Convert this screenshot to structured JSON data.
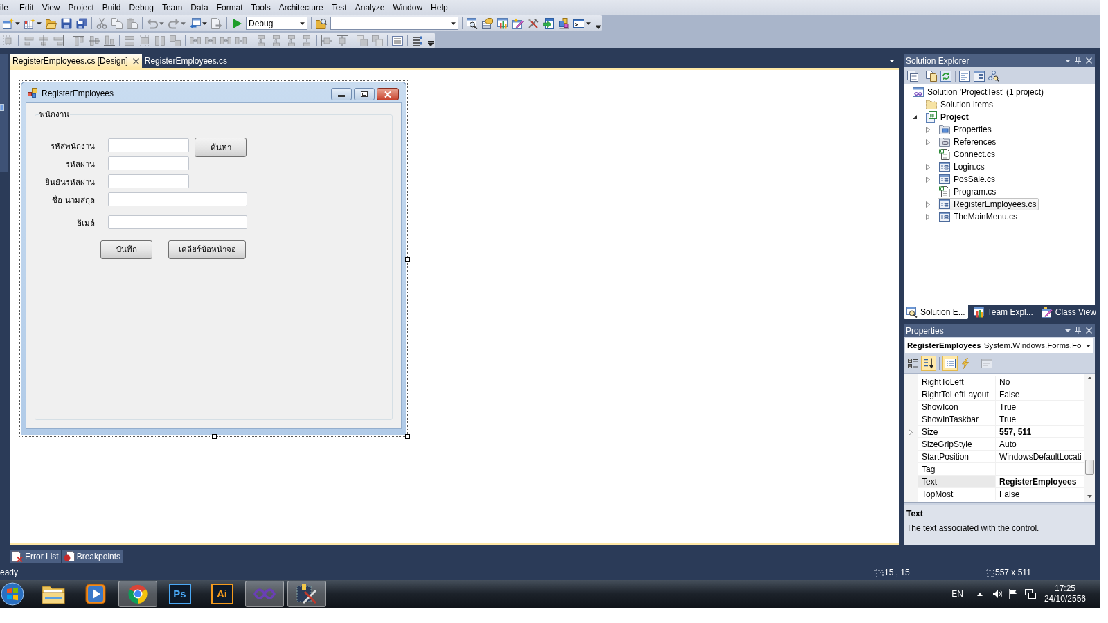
{
  "menu_bar": {
    "items": [
      "ile",
      "Edit",
      "View",
      "Project",
      "Build",
      "Debug",
      "Team",
      "Data",
      "Format",
      "Tools",
      "Architecture",
      "Test",
      "Analyze",
      "Window",
      "Help"
    ]
  },
  "toolbars": [
    {
      "groups": [
        [
          {
            "kind": "new_project",
            "dropdown": true,
            "disabled": false
          },
          {
            "kind": "add_item",
            "dropdown": true,
            "disabled": false
          },
          {
            "kind": "open",
            "disabled": false
          },
          {
            "kind": "save",
            "disabled": false
          },
          {
            "kind": "save_all",
            "disabled": false
          }
        ],
        [
          {
            "kind": "cut",
            "disabled": true
          },
          {
            "kind": "copy",
            "disabled": true
          },
          {
            "kind": "paste",
            "disabled": true
          }
        ],
        [
          {
            "kind": "undo",
            "dropdown": true,
            "disabled": true
          },
          {
            "kind": "redo",
            "dropdown": true,
            "disabled": true
          },
          {
            "kind": "navigate_back",
            "dropdown": true,
            "disabled": false
          },
          {
            "kind": "navigate_forward",
            "disabled": true
          }
        ],
        [
          {
            "kind": "start",
            "disabled": false
          },
          {
            "kind": "config_combo",
            "value": "Debug",
            "disabled": false
          }
        ],
        [
          {
            "kind": "find_in_files",
            "disabled": false
          },
          {
            "kind": "find_combo",
            "disabled": false
          }
        ],
        [
          {
            "kind": "window_search",
            "disabled": false
          },
          {
            "kind": "hand",
            "disabled": false
          },
          {
            "kind": "chart",
            "disabled": false
          },
          {
            "kind": "window_pencil",
            "disabled": false
          },
          {
            "kind": "tools",
            "disabled": false
          },
          {
            "kind": "arrow_box",
            "disabled": false
          },
          {
            "kind": "blocks",
            "disabled": false
          },
          {
            "kind": "console",
            "dropdown": true,
            "disabled": false
          }
        ]
      ]
    },
    {
      "groups": [
        [
          {
            "kind": "grid",
            "disabled": true
          }
        ],
        [
          {
            "kind": "align_left",
            "disabled": true
          },
          {
            "kind": "align_center",
            "disabled": true
          },
          {
            "kind": "align_right",
            "disabled": true
          }
        ],
        [
          {
            "kind": "align_top",
            "disabled": true
          },
          {
            "kind": "align_middle",
            "disabled": true
          },
          {
            "kind": "align_bottom",
            "disabled": true
          }
        ],
        [
          {
            "kind": "same_width",
            "disabled": true
          },
          {
            "kind": "size_to_grid",
            "disabled": true
          },
          {
            "kind": "same_height",
            "disabled": true
          },
          {
            "kind": "same_size",
            "disabled": true
          }
        ],
        [
          {
            "kind": "hspace_equal",
            "disabled": true
          },
          {
            "kind": "hspace_increase",
            "disabled": true
          },
          {
            "kind": "hspace_decrease",
            "disabled": true
          },
          {
            "kind": "hspace_remove",
            "disabled": true
          }
        ],
        [
          {
            "kind": "vspace_equal",
            "disabled": true
          },
          {
            "kind": "vspace_increase",
            "disabled": true
          },
          {
            "kind": "vspace_decrease",
            "disabled": true
          },
          {
            "kind": "vspace_remove",
            "disabled": true
          }
        ],
        [
          {
            "kind": "center_horizontal",
            "disabled": true
          },
          {
            "kind": "center_vertical",
            "disabled": true
          }
        ],
        [
          {
            "kind": "bring_front",
            "disabled": true
          },
          {
            "kind": "send_back",
            "disabled": true
          }
        ],
        [
          {
            "kind": "lines",
            "disabled": false
          }
        ],
        [
          {
            "kind": "tab_order",
            "disabled": false
          }
        ]
      ]
    }
  ],
  "document_tabs": [
    {
      "label": "RegisterEmployees.cs [Design]",
      "selected": true
    },
    {
      "label": "RegisterEmployees.cs",
      "selected": false
    }
  ],
  "designer": {
    "form": {
      "title": "RegisterEmployees",
      "selected": true,
      "group": {
        "title": "พนักงาน",
        "fields": [
          {
            "label": "รหัสพนักงาน",
            "button": "ค้นหา"
          },
          {
            "label": "รหัสผ่าน"
          },
          {
            "label": "ยินยันรหัสผ่าน"
          },
          {
            "label": "ชื่อ-นามสกุล"
          },
          {
            "label": "อิเมล์"
          }
        ],
        "actions": [
          "บันทึก",
          "เคลียร์ข้อหน้าจอ"
        ]
      }
    }
  },
  "solution_explorer": {
    "title": "Solution Explorer",
    "tree": [
      {
        "label": "Solution 'ProjectTest' (1 project)",
        "kind": "solution",
        "expandable": false,
        "selected": false,
        "startup": false,
        "children": [
          {
            "label": "Solution Items",
            "kind": "folder",
            "expandable": false,
            "selected": false,
            "startup": false
          },
          {
            "label": "Project",
            "kind": "project",
            "expandable": true,
            "expanded": true,
            "selected": false,
            "startup": true,
            "children": [
              {
                "label": "Properties",
                "kind": "properties",
                "expandable": true,
                "expanded": false,
                "selected": false,
                "startup": false
              },
              {
                "label": "References",
                "kind": "references",
                "expandable": true,
                "expanded": false,
                "selected": false,
                "startup": false
              },
              {
                "label": "Connect.cs",
                "kind": "code",
                "expandable": false,
                "selected": false,
                "startup": false
              },
              {
                "label": "Login.cs",
                "kind": "form",
                "expandable": true,
                "expanded": false,
                "selected": false,
                "startup": false
              },
              {
                "label": "PosSale.cs",
                "kind": "form",
                "expandable": true,
                "expanded": false,
                "selected": false,
                "startup": false
              },
              {
                "label": "Program.cs",
                "kind": "code",
                "expandable": false,
                "selected": false,
                "startup": false
              },
              {
                "label": "RegisterEmployees.cs",
                "kind": "form",
                "expandable": true,
                "expanded": false,
                "selected": true,
                "startup": false
              },
              {
                "label": "TheMainMenu.cs",
                "kind": "form",
                "expandable": true,
                "expanded": false,
                "selected": false,
                "startup": false
              }
            ]
          }
        ]
      }
    ],
    "tabs": [
      {
        "label": "Solution E...",
        "kind": "solution_explorer",
        "selected": true
      },
      {
        "label": "Team Expl...",
        "kind": "team_explorer",
        "selected": false
      },
      {
        "label": "Class View",
        "kind": "class_view",
        "selected": false
      }
    ]
  },
  "properties": {
    "title": "Properties",
    "object": {
      "name": "RegisterEmployees",
      "type": "System.Windows.Forms.Fo"
    },
    "toolbar": [
      [
        {
          "kind": "categorized",
          "selected": false,
          "disabled": false
        },
        {
          "kind": "alphabetical",
          "selected": true,
          "disabled": false
        }
      ],
      [
        {
          "kind": "properties",
          "selected": true,
          "disabled": false
        },
        {
          "kind": "events",
          "selected": false,
          "disabled": false
        }
      ],
      [
        {
          "kind": "property_pages",
          "selected": false,
          "disabled": true
        }
      ]
    ],
    "rows": [
      {
        "name": "RightToLeft",
        "value": "No",
        "expandable": false,
        "modified": false,
        "selected": false
      },
      {
        "name": "RightToLeftLayout",
        "value": "False",
        "expandable": false,
        "modified": false,
        "selected": false
      },
      {
        "name": "ShowIcon",
        "value": "True",
        "expandable": false,
        "modified": false,
        "selected": false
      },
      {
        "name": "ShowInTaskbar",
        "value": "True",
        "expandable": false,
        "modified": false,
        "selected": false
      },
      {
        "name": "Size",
        "value": "557, 511",
        "expandable": true,
        "modified": true,
        "selected": false
      },
      {
        "name": "SizeGripStyle",
        "value": "Auto",
        "expandable": false,
        "modified": false,
        "selected": false
      },
      {
        "name": "StartPosition",
        "value": "WindowsDefaultLocati",
        "expandable": false,
        "modified": false,
        "selected": false
      },
      {
        "name": "Tag",
        "expandable": false,
        "selected": false
      },
      {
        "name": "Text",
        "value": "RegisterEmployees",
        "expandable": false,
        "modified": true,
        "selected": true
      },
      {
        "name": "TopMost",
        "value": "False",
        "expandable": false,
        "modified": false,
        "selected": false
      }
    ],
    "description": {
      "title": "Text",
      "text": "The text associated with the control."
    }
  },
  "tool_tabs": [
    {
      "label": "Error List",
      "kind": "error_list"
    },
    {
      "label": "Breakpoints",
      "kind": "breakpoints"
    }
  ],
  "status_bar": {
    "text": "eady",
    "position": "15 , 15",
    "size": "557 x 511"
  },
  "taskbar": {
    "items": [
      {
        "kind": "folder",
        "running": false
      },
      {
        "kind": "media",
        "running": false
      },
      {
        "kind": "browser",
        "running": true
      },
      {
        "kind": "logo",
        "label": "Ps",
        "color": "#4aa8f5",
        "running": false
      },
      {
        "kind": "logo",
        "label": "Ai",
        "color": "#f59b1c",
        "running": false
      },
      {
        "kind": "infinity",
        "running": true
      },
      {
        "kind": "tools",
        "running": true
      }
    ],
    "tray": {
      "language": "EN",
      "time": "17:25",
      "date": "24/10/2556"
    }
  }
}
